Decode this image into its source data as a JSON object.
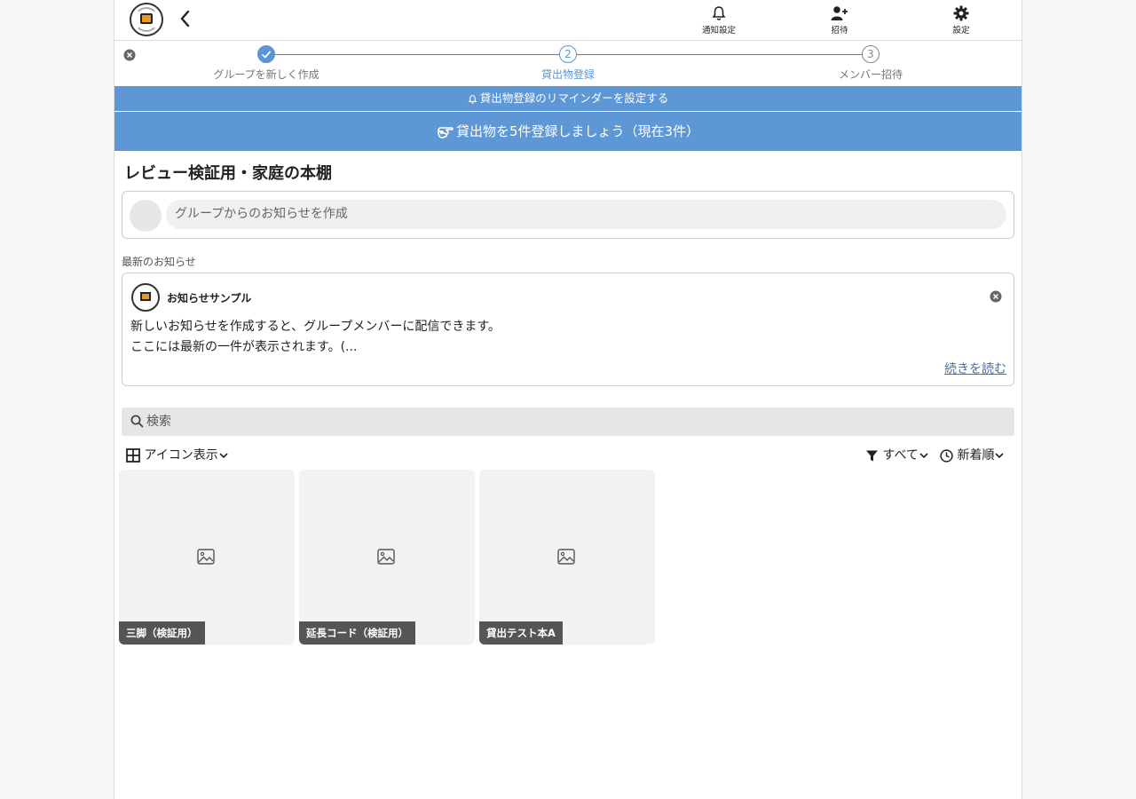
{
  "header": {
    "notify_label": "通知設定",
    "invite_label": "招待",
    "settings_label": "設定"
  },
  "stepper": {
    "steps": [
      {
        "label": "グループを新しく作成",
        "number": "",
        "state": "done"
      },
      {
        "label": "貸出物登録",
        "number": "2",
        "state": "active"
      },
      {
        "label": "メンバー招待",
        "number": "3",
        "state": "todo"
      }
    ]
  },
  "banners": {
    "reminder": "貸出物登録のリマインダーを設定する",
    "goal": "貸出物を5件登録しましょう（現在3件）"
  },
  "group": {
    "title": "レビュー検証用・家庭の本棚"
  },
  "post": {
    "placeholder": "グループからのお知らせを作成"
  },
  "news": {
    "section_label": "最新のお知らせ",
    "title": "お知らせサンプル",
    "line1": "新しいお知らせを作成すると、グループメンバーに配信できます。",
    "line2": "ここには最新の一件が表示されます。(...",
    "more": "続きを読む"
  },
  "search": {
    "placeholder": "検索"
  },
  "controls": {
    "view": "アイコン表示",
    "filter": "すべて",
    "sort": "新着順"
  },
  "items": [
    {
      "name": "三脚（検証用）"
    },
    {
      "name": "延長コード（検証用）"
    },
    {
      "name": "貸出テスト本A"
    }
  ],
  "colors": {
    "accent": "#5e97d6",
    "link": "#4a6fa5"
  }
}
